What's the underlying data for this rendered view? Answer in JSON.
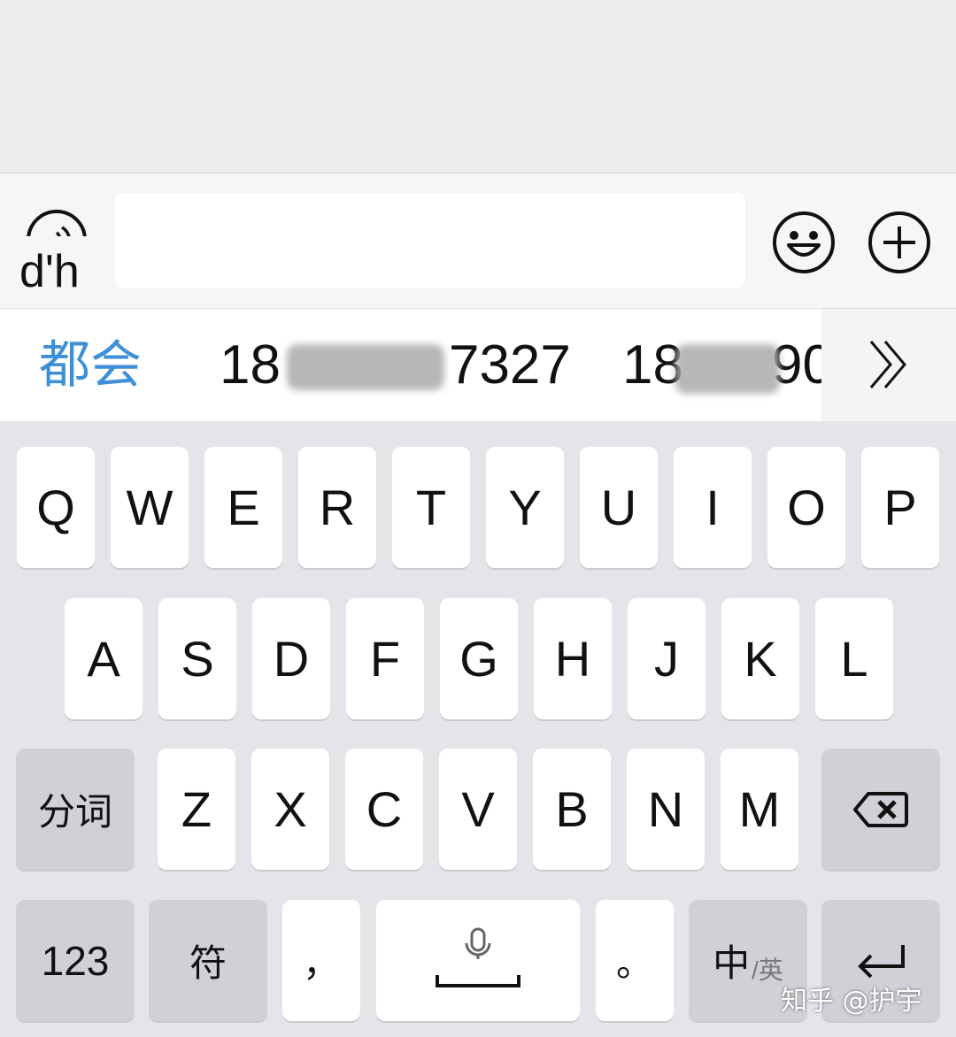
{
  "input_bar": {
    "pinyin_preview": "d'h",
    "text_value": ""
  },
  "candidates": {
    "first": "都会",
    "second_prefix": "18",
    "second_suffix": "7327",
    "third_prefix": "18",
    "third_suffix": "90"
  },
  "keyboard": {
    "row1": [
      "Q",
      "W",
      "E",
      "R",
      "T",
      "Y",
      "U",
      "I",
      "O",
      "P"
    ],
    "row2": [
      "A",
      "S",
      "D",
      "F",
      "G",
      "H",
      "J",
      "K",
      "L"
    ],
    "row3": [
      "Z",
      "X",
      "C",
      "V",
      "B",
      "N",
      "M"
    ],
    "segment_label": "分词",
    "numbers_label": "123",
    "symbols_label": "符",
    "comma_label": "，",
    "period_label": "。",
    "lang_main": "中",
    "lang_sub": "/英"
  },
  "watermark": "知乎 @护宇",
  "colors": {
    "accent": "#3d8fd8",
    "keyboard_bg": "#e4e5e9",
    "func_key": "#cfd1d6"
  }
}
